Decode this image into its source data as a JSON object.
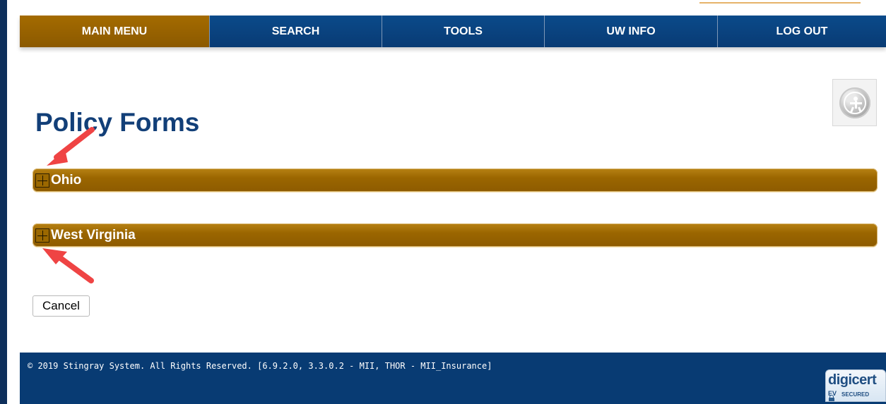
{
  "nav": {
    "items": [
      {
        "label": "MAIN MENU"
      },
      {
        "label": "SEARCH"
      },
      {
        "label": "TOOLS"
      },
      {
        "label": "UW INFO"
      },
      {
        "label": "LOG OUT"
      }
    ]
  },
  "main": {
    "title": "Policy Forms",
    "sections": [
      {
        "label": "Ohio"
      },
      {
        "label": "West Virginia"
      }
    ],
    "cancel_label": "Cancel"
  },
  "footer": {
    "copyright": "© 2019 Stingray System. All Rights Reserved. [6.9.2.0, 3.3.0.2 - MII, THOR - MII_Insurance]",
    "badge_name": "digicert",
    "badge_ev": "EV",
    "badge_secured": "SECURED"
  },
  "icons": {
    "accessibility": "accessibility-icon",
    "expand": "plus-square-icon",
    "lock": "lock-icon",
    "annotation": "red-arrow-icon"
  },
  "colors": {
    "navy": "#083b73",
    "gold": "#9b6600",
    "title": "#123f78",
    "annotation": "#ef4444"
  }
}
